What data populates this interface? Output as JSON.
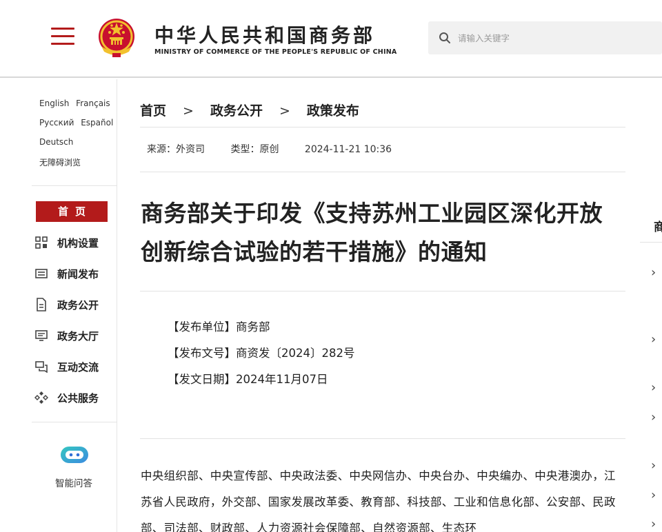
{
  "header": {
    "title": "中华人民共和国商务部",
    "subtitle": "MINISTRY OF COMMERCE OF THE PEOPLE'S REPUBLIC OF CHINA",
    "search_placeholder": "请输入关键字",
    "brand_color": "#b31b1b"
  },
  "sidebar": {
    "languages": [
      "English",
      "Français",
      "Русский",
      "Español",
      "Deutsch"
    ],
    "accessibility": "无障碍浏览",
    "home": "首页",
    "items": [
      {
        "label": "机构设置",
        "icon": "org-structure-icon"
      },
      {
        "label": "新闻发布",
        "icon": "news-icon"
      },
      {
        "label": "政务公开",
        "icon": "document-icon"
      },
      {
        "label": "政务大厅",
        "icon": "hall-monitor-icon"
      },
      {
        "label": "互动交流",
        "icon": "chat-icon"
      },
      {
        "label": "公共服务",
        "icon": "service-icon"
      }
    ],
    "assistant": "智能问答"
  },
  "breadcrumb": [
    "首页",
    "政务公开",
    "政策发布"
  ],
  "breadcrumb_sep": ">",
  "meta": {
    "source": "来源：外资司",
    "type": "类型：原创",
    "datetime": "2024-11-21 10:36"
  },
  "article": {
    "title": "商务部关于印发《支持苏州工业园区深化开放创新综合试验的若干措施》的通知",
    "issuer": "【发布单位】商务部",
    "doc_number": "【发布文号】商资发〔2024〕282号",
    "issue_date": "【发文日期】2024年11月07日",
    "body": "中央组织部、中央宣传部、中央政法委、中央网信办、中央台办、中央编办、中央港澳办，江苏省人民政府，外交部、国家发展改革委、教育部、科技部、工业和信息化部、公安部、民政部、司法部、财政部、人力资源社会保障部、自然资源部、生态环"
  },
  "right_column": {
    "heading": "商"
  }
}
